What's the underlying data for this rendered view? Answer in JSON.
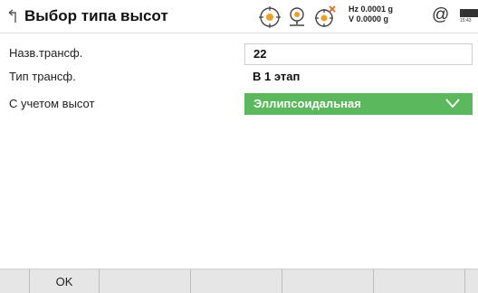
{
  "header": {
    "title": "Выбор типа высот",
    "hz_line": "Hz 0.0001 g",
    "v_line": "V  0.0000 g",
    "at_symbol": "@",
    "time": "15:43",
    "icons": [
      "back-icon",
      "target-icon",
      "prism-icon",
      "compensator-off-icon",
      "battery-icon"
    ]
  },
  "form": {
    "fields": [
      {
        "label": "Назв.трансф.",
        "value": "22"
      },
      {
        "label": "Тип трансф.",
        "value": "В 1 этап"
      },
      {
        "label": "С учетом высот",
        "value": "Эллипсоидальная"
      }
    ]
  },
  "footer": {
    "keys": [
      "",
      "OK",
      "",
      "",
      "",
      ""
    ]
  },
  "colors": {
    "accent_green": "#5cb85c",
    "footer_bg": "#e6e6e6"
  }
}
